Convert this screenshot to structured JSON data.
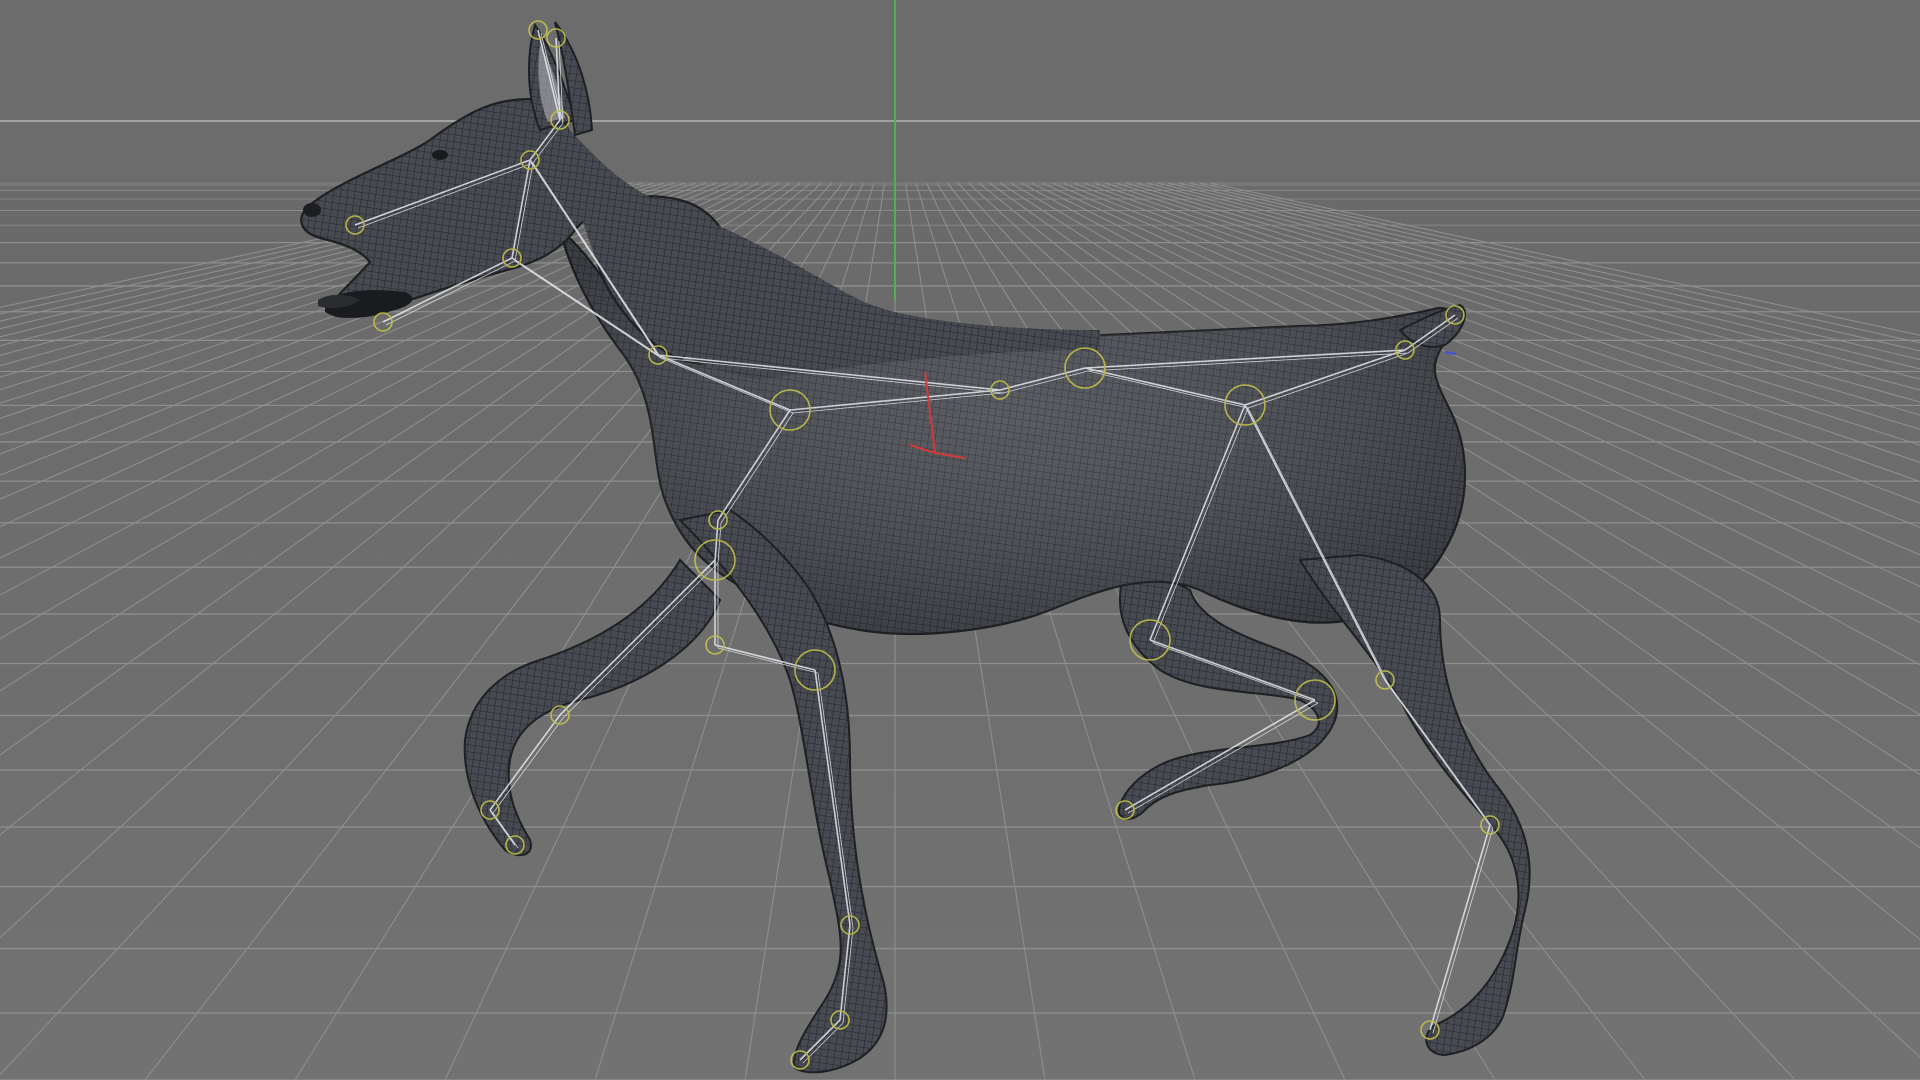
{
  "viewport": {
    "view": "perspective",
    "background_color": "#6c6c6c",
    "floor_color": "#707070",
    "grid_color": "#8e8e8e",
    "horizon_color": "#a2a2a2",
    "y_axis_color": "#4fb24f",
    "x_axis_color": "#d23a3a",
    "z_axis_color": "#3a52d6"
  },
  "scene": {
    "object": "dog",
    "display_mode": "shaded-wireframe",
    "mesh_color": "#44474d",
    "wire_color": "#22252a",
    "bone_color": "#e6e8ec",
    "joint_color": "#c9c84a"
  }
}
